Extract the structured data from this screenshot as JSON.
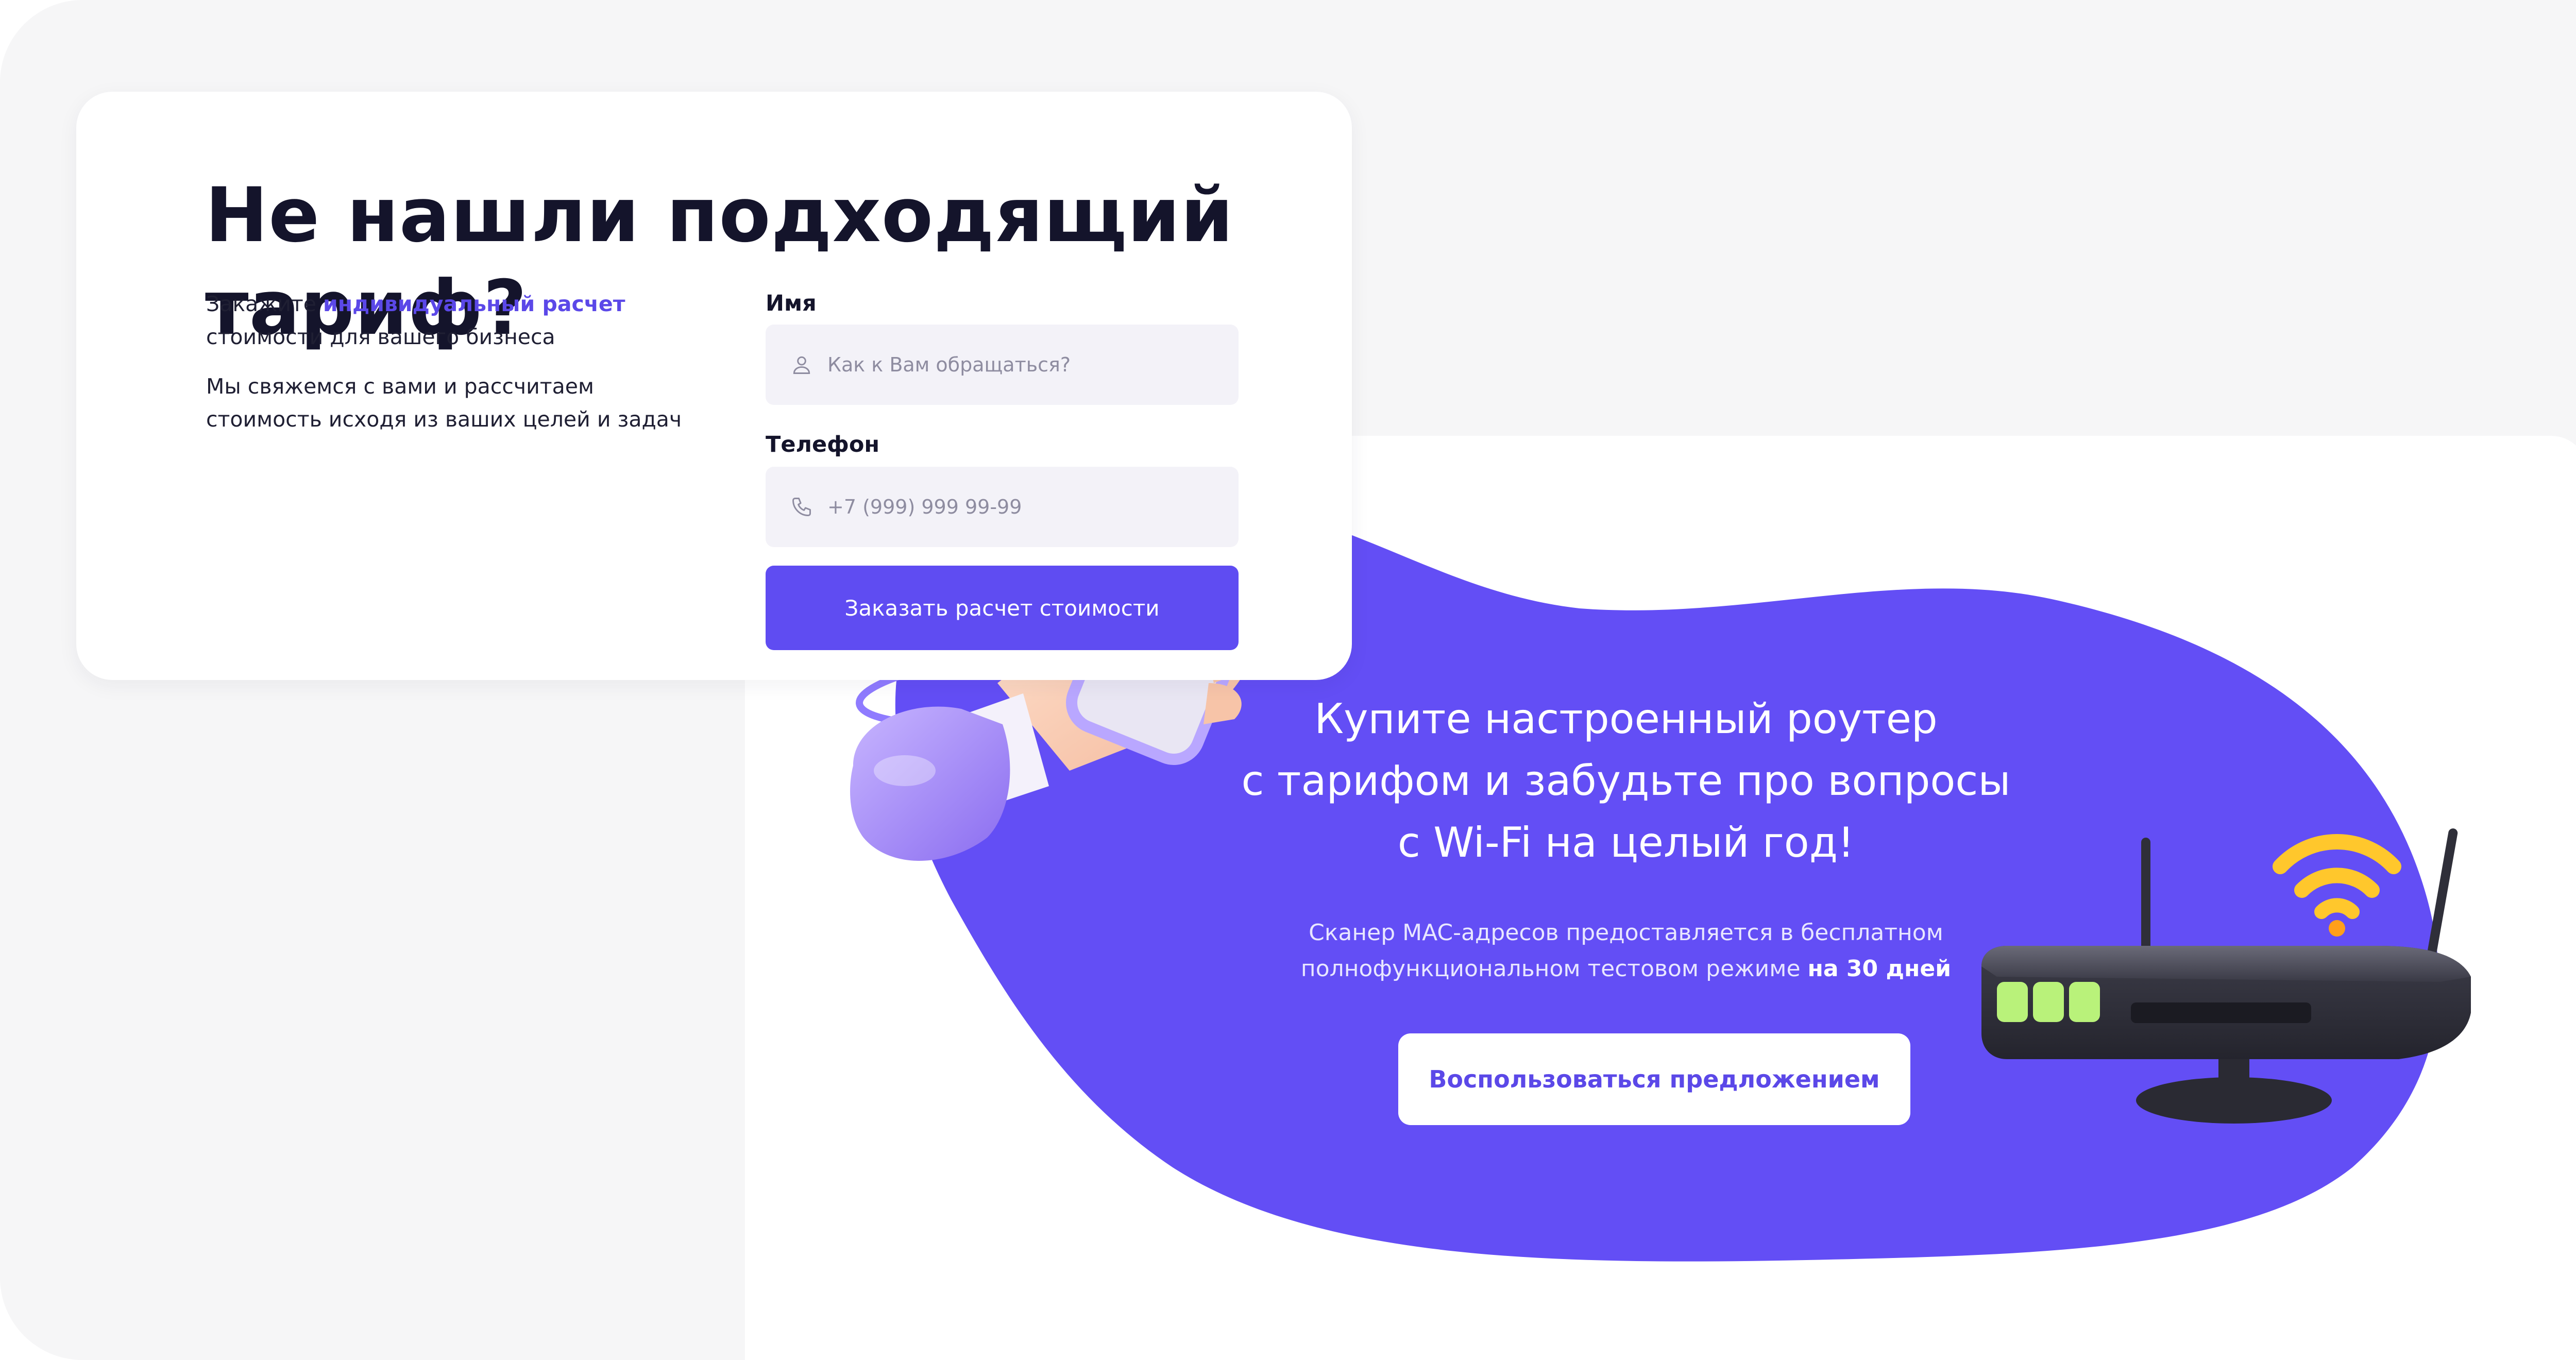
{
  "form_card": {
    "title": "Не нашли подходящий тариф?",
    "desc1": {
      "prefix": "Закажите ",
      "highlight": "индивидуальный расчет",
      "suffix": " стоимости для вашего бизнеса"
    },
    "desc2": "Мы свяжемся с вами и рассчитаем стоимость исходя из ваших целей и задач",
    "name_field": {
      "label": "Имя",
      "placeholder": "Как к Вам обращаться?",
      "value": "",
      "icon": "user-icon"
    },
    "phone_field": {
      "label": "Телефон",
      "placeholder": "+7 (999) 999 99-99",
      "value": "",
      "icon": "phone-icon"
    },
    "submit_label": "Заказать расчет стоимости"
  },
  "promo": {
    "title": "Купите настроенный роутер\nс тарифом и забудьте про вопросы\nс Wi-Fi на целый год!",
    "subtitle_prefix": "Сканер MAC-адресов предоставляется в бесплатном полнофункциональном тестовом режиме ",
    "subtitle_bold": "на 30 дней",
    "button_label": "Воспользоваться предложением",
    "illustrations": [
      "hand-with-phone-illustration",
      "router-illustration",
      "wifi-icon"
    ]
  },
  "colors": {
    "accent": "#5f4cf2",
    "blob": "#634ef5",
    "heading": "#14142b",
    "page_bg": "#f6f6f7",
    "field_bg": "#f3f2f8",
    "wifi": "#ffc72c"
  }
}
